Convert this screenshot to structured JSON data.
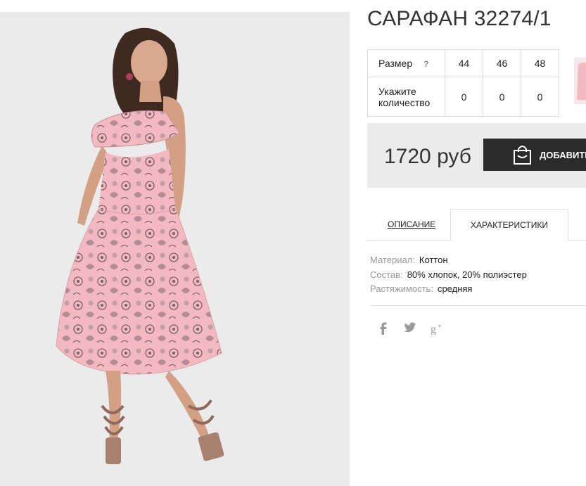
{
  "product": {
    "title": "САРАФАН 32274/1",
    "price": "1720 руб",
    "add_button_label": "ДОБАВИТЬ"
  },
  "size_table": {
    "size_label": "Размер",
    "help": "?",
    "sizes": [
      "44",
      "46",
      "48"
    ],
    "quantity_label_line1": "Укажите",
    "quantity_label_line2": "количество",
    "quantities": [
      "0",
      "0",
      "0"
    ]
  },
  "tabs": {
    "description": "ОПИСАНИЕ",
    "characteristics": "ХАРАКТЕРИСТИКИ"
  },
  "properties": [
    {
      "key": "Материал:",
      "value": "Коттон"
    },
    {
      "key": "Состав:",
      "value": "80% хлопок, 20% полиэстер"
    },
    {
      "key": "Растяжимость:",
      "value": "средняя"
    }
  ],
  "social_icons": [
    "facebook-icon",
    "twitter-icon",
    "google-plus-icon"
  ],
  "colors": {
    "button_bg": "#2b2b2b",
    "price_box_bg": "#ebebeb",
    "photo_bg": "#ecebec",
    "dress_pink": "#f2b9c0"
  }
}
